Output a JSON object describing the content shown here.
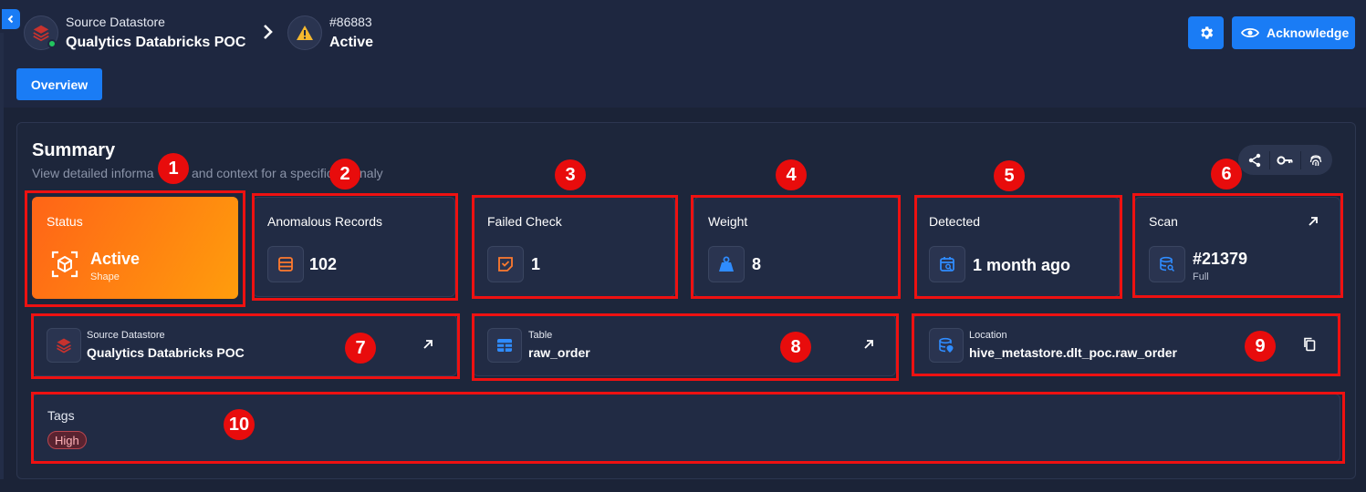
{
  "header": {
    "datastore_caption": "Source Datastore",
    "datastore_name": "Qualytics Databricks POC",
    "anomaly_id": "#86883",
    "anomaly_status": "Active",
    "acknowledge_label": "Acknowledge"
  },
  "tabs": [
    {
      "label": "Overview"
    }
  ],
  "summary": {
    "title": "Summary",
    "subtitle_left": "View detailed informa",
    "subtitle_mid": "and context for a specific",
    "subtitle_right": "naly"
  },
  "cards": {
    "status": {
      "label": "Status",
      "value": "Active",
      "sub": "Shape"
    },
    "anomalous_records": {
      "label": "Anomalous Records",
      "value": "102"
    },
    "failed_check": {
      "label": "Failed Check",
      "value": "1"
    },
    "weight": {
      "label": "Weight",
      "value": "8"
    },
    "detected": {
      "label": "Detected",
      "value": "1 month ago"
    },
    "scan": {
      "label": "Scan",
      "value": "#21379",
      "sub": "Full"
    },
    "source_datastore": {
      "label": "Source Datastore",
      "value": "Qualytics Databricks POC"
    },
    "table": {
      "label": "Table",
      "value": "raw_order"
    },
    "location": {
      "label": "Location",
      "value": "hive_metastore.dlt_poc.raw_order"
    },
    "tags": {
      "label": "Tags",
      "items": [
        "High"
      ]
    }
  },
  "annotations": [
    "1",
    "2",
    "3",
    "4",
    "5",
    "6",
    "7",
    "8",
    "9",
    "10"
  ],
  "colors": {
    "accent": "#1a7cf5",
    "status_gradient_start": "#ff6417",
    "status_gradient_end": "#ff9d0c",
    "annotation_red": "#e80c0c",
    "tag_high": "#b9464f"
  }
}
